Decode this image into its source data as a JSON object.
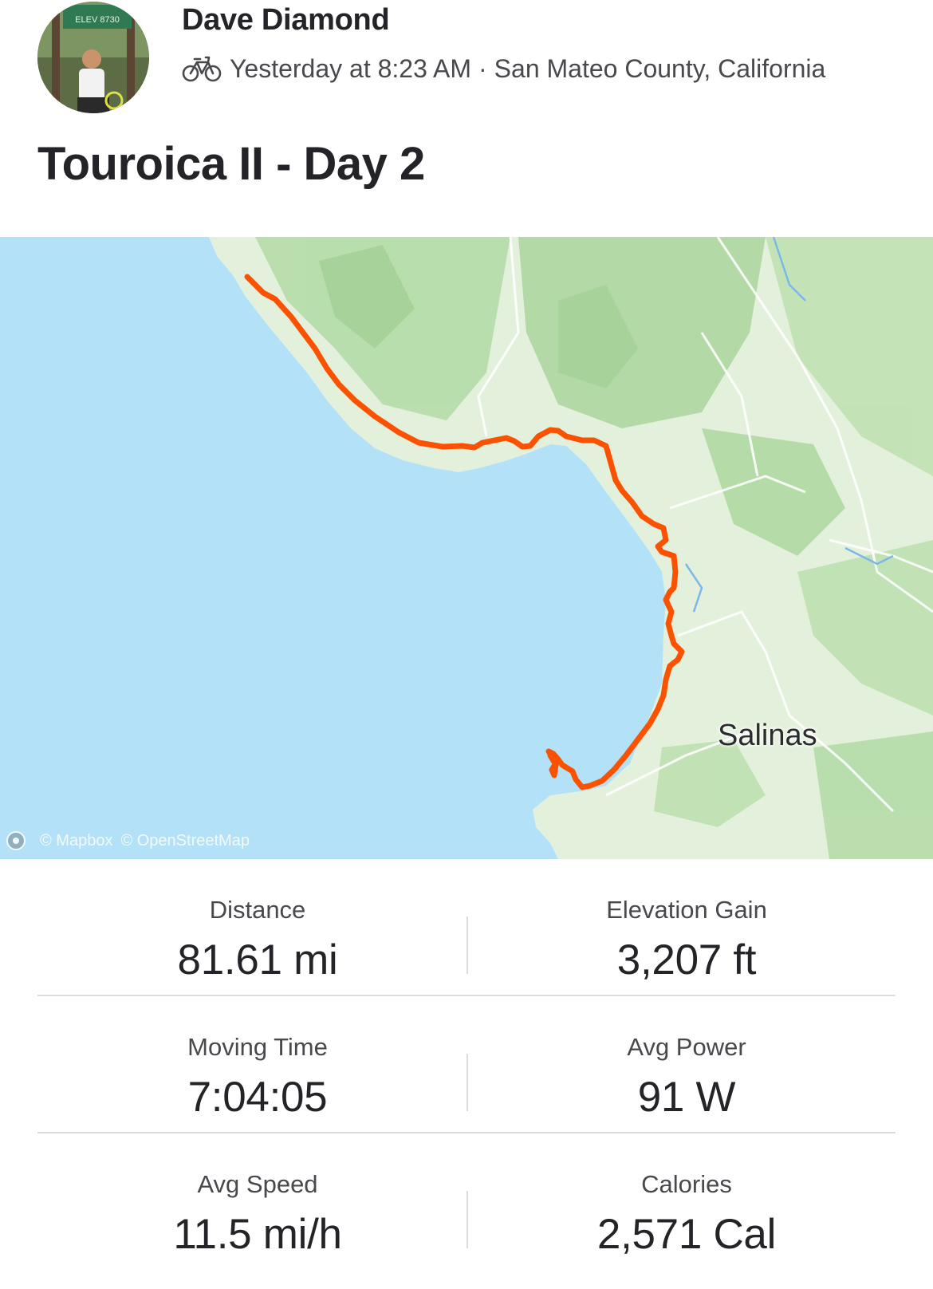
{
  "athlete": {
    "name": "Dave Diamond",
    "activity_time": "Yesterday at 8:23 AM",
    "location": "San Mateo County, California",
    "separator": "·",
    "activity_icon": "bike-icon",
    "avatar_sign_text": "ELEV 8730"
  },
  "activity": {
    "title": "Touroica II - Day 2"
  },
  "map": {
    "place_label": "Salinas",
    "attribution_mapbox": "© Mapbox",
    "attribution_osm": "© OpenStreetMap",
    "route_color": "#fc5200",
    "water_color": "#b3e2f8",
    "land_color": "#e3f1dc"
  },
  "stats": [
    {
      "label": "Distance",
      "value": "81.61 mi"
    },
    {
      "label": "Elevation Gain",
      "value": "3,207 ft"
    },
    {
      "label": "Moving Time",
      "value": "7:04:05"
    },
    {
      "label": "Avg Power",
      "value": "91 W"
    },
    {
      "label": "Avg Speed",
      "value": "11.5 mi/h"
    },
    {
      "label": "Calories",
      "value": "2,571 Cal"
    }
  ]
}
